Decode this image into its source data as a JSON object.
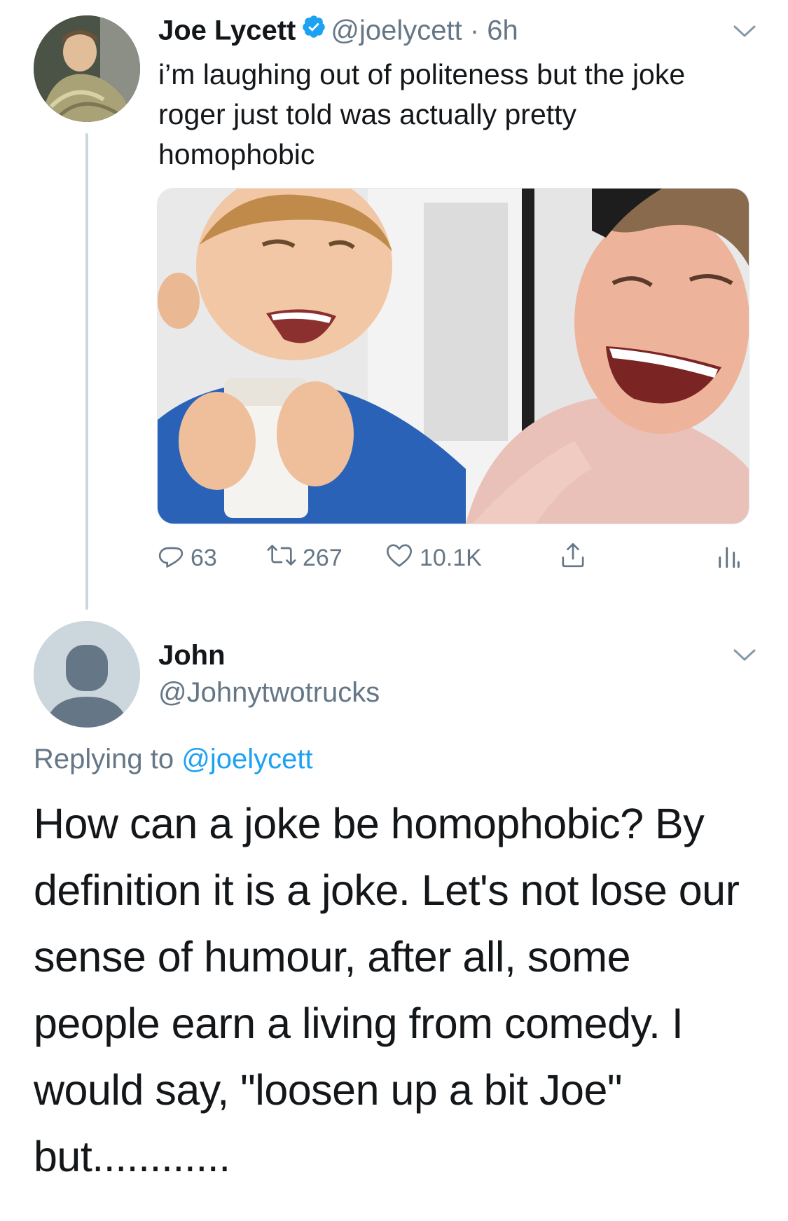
{
  "tweet": {
    "author_name": "Joe Lycett",
    "handle": "@joelycett",
    "separator": "·",
    "time": "6h",
    "text": "i’m laughing out of politeness but the joke roger just told was actually pretty homophobic",
    "stats": {
      "replies": "63",
      "retweets": "267",
      "likes": "10.1K"
    }
  },
  "reply": {
    "author_name": "John",
    "handle": "@Johnytwotrucks",
    "replying_prefix": "Replying to",
    "replying_to": "@joelycett",
    "text": "How can a joke be homophobic? By definition it is a joke. Let's not lose our sense of humour,  after all, some people earn a living from comedy. I would say, \"loosen up a bit Joe\" but............"
  },
  "icons": {
    "verified": "verified-badge-icon",
    "reply": "reply-icon",
    "retweet": "retweet-icon",
    "like": "heart-icon",
    "share": "share-icon",
    "analytics": "analytics-icon",
    "menu": "chevron-down-icon"
  },
  "colors": {
    "accent": "#1da1f2",
    "text": "#14171a",
    "secondary": "#657786",
    "divider": "#ccd6dd"
  }
}
